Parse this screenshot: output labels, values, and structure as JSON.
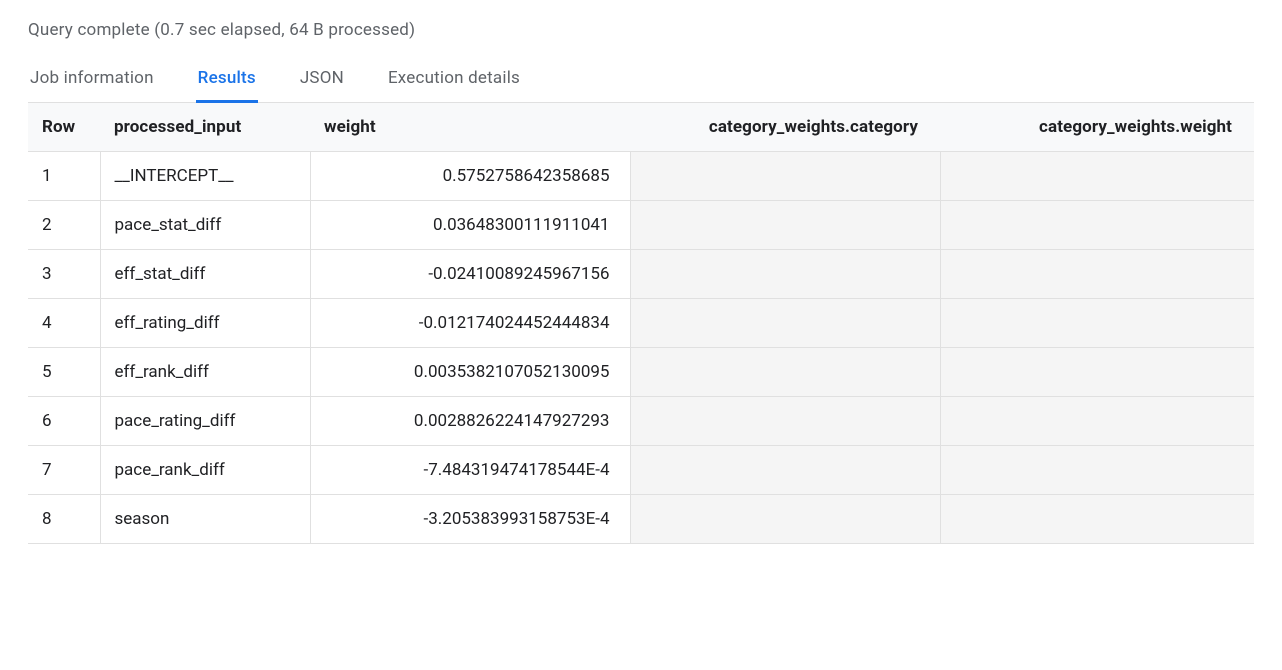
{
  "status": "Query complete (0.7 sec elapsed, 64 B processed)",
  "tabs": {
    "job_info": "Job information",
    "results": "Results",
    "json": "JSON",
    "exec": "Execution details"
  },
  "table": {
    "headers": {
      "row": "Row",
      "processed_input": "processed_input",
      "weight": "weight",
      "cat_category": "category_weights.category",
      "cat_weight": "category_weights.weight"
    },
    "rows": [
      {
        "n": "1",
        "processed_input": "__INTERCEPT__",
        "weight": "0.5752758642358685"
      },
      {
        "n": "2",
        "processed_input": "pace_stat_diff",
        "weight": "0.03648300111911041"
      },
      {
        "n": "3",
        "processed_input": "eff_stat_diff",
        "weight": "-0.02410089245967156"
      },
      {
        "n": "4",
        "processed_input": "eff_rating_diff",
        "weight": "-0.012174024452444834"
      },
      {
        "n": "5",
        "processed_input": "eff_rank_diff",
        "weight": "0.0035382107052130095"
      },
      {
        "n": "6",
        "processed_input": "pace_rating_diff",
        "weight": "0.0028826224147927293"
      },
      {
        "n": "7",
        "processed_input": "pace_rank_diff",
        "weight": "-7.484319474178544E-4"
      },
      {
        "n": "8",
        "processed_input": "season",
        "weight": "-3.205383993158753E-4"
      }
    ]
  }
}
